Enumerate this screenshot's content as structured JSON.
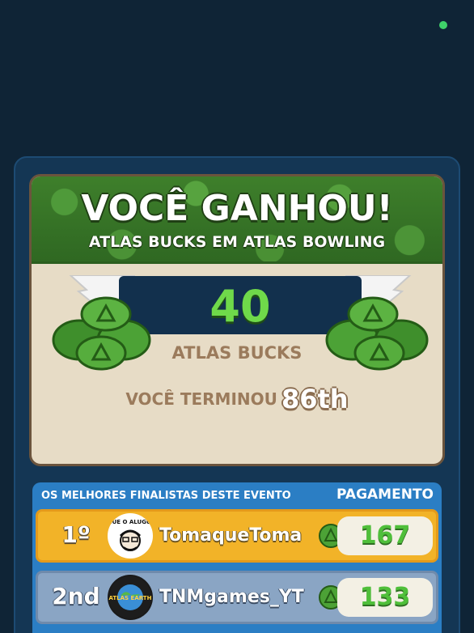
{
  "reward": {
    "title": "VOCÊ GANHOU!",
    "subtitle": "ATLAS BUCKS EM ATLAS BOWLING",
    "amount": "40",
    "currency_label": "ATLAS BUCKS",
    "finish_label": "VOCÊ TERMINOU",
    "finish_rank": "86th"
  },
  "leaderboard": {
    "header_left": "OS MELHORES FINALISTAS DESTE EVENTO",
    "header_right": "PAGAMENTO",
    "rows": [
      {
        "rank": "1º",
        "name": "TomaqueToma",
        "payout": "167",
        "avatar_text": "PAGUE O ALUGUEL!"
      },
      {
        "rank": "2nd",
        "name": "TNMgames_YT",
        "payout": "133",
        "avatar_text": "ATLAS EARTH"
      }
    ]
  },
  "colors": {
    "background": "#0f2436",
    "accent_green": "#6fd94a",
    "gold_row": "#f2b328",
    "silver_row": "#8aa5c4"
  }
}
